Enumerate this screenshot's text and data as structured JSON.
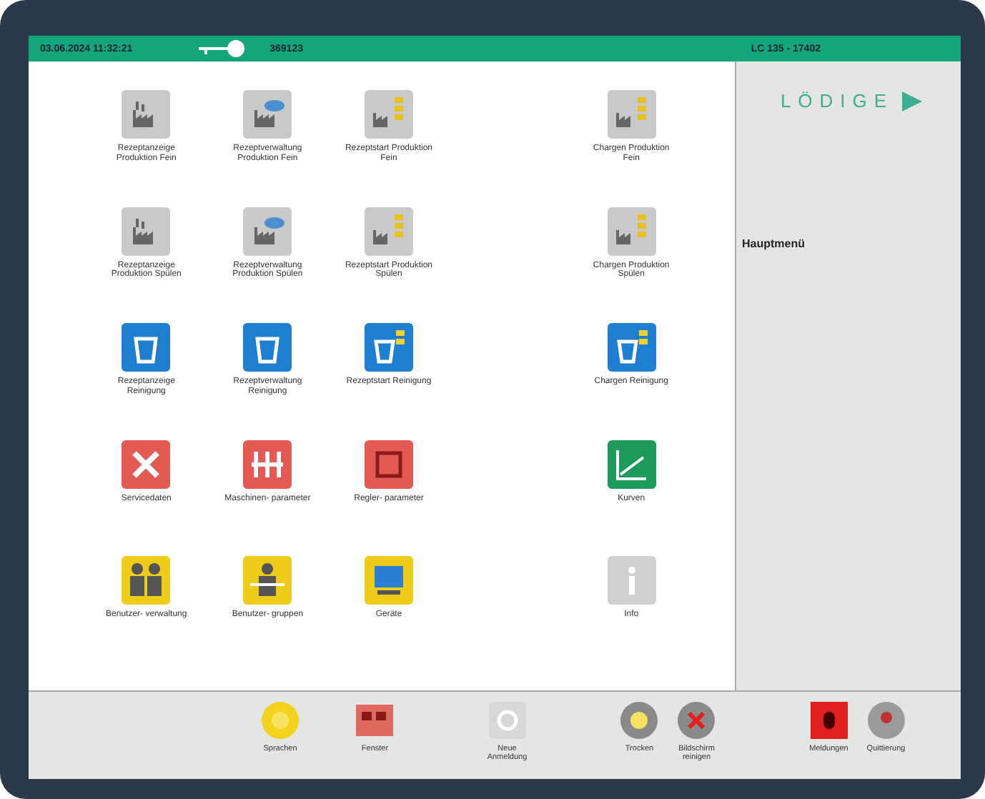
{
  "header": {
    "datetime": "03.06.2024  11:32:21",
    "user_id": "369123",
    "machine": "LC 135 - 17402"
  },
  "menu_rows": [
    {
      "tiles": [
        {
          "label": "Rezeptanzeige Produktion Fein",
          "kind": "factory",
          "color": "#c9c9c9"
        },
        {
          "label": "Rezeptverwaltung Produktion Fein",
          "kind": "factory-cloud",
          "color": "#c9c9c9"
        },
        {
          "label": "Rezeptstart Produktion Fein",
          "kind": "factory-coins",
          "color": "#c9c9c9"
        },
        {
          "label": "Chargen Produktion Fein",
          "kind": "factory-coins",
          "color": "#c9c9c9"
        }
      ]
    },
    {
      "tiles": [
        {
          "label": "Rezeptanzeige Produktion Spülen",
          "kind": "factory",
          "color": "#c9c9c9"
        },
        {
          "label": "Rezeptverwaltung Produktion Spülen",
          "kind": "factory-cloud",
          "color": "#c9c9c9"
        },
        {
          "label": "Rezeptstart Produktion Spülen",
          "kind": "factory-coins",
          "color": "#c9c9c9"
        },
        {
          "label": "Chargen Produktion Spülen",
          "kind": "factory-coins",
          "color": "#c9c9c9"
        }
      ]
    },
    {
      "tiles": [
        {
          "label": "Rezeptanzeige Reinigung",
          "kind": "bucket",
          "color": "#1e7fd0"
        },
        {
          "label": "Rezeptverwaltung Reinigung",
          "kind": "bucket",
          "color": "#1e7fd0"
        },
        {
          "label": "Rezeptstart Reinigung",
          "kind": "bucket-coins",
          "color": "#1e7fd0"
        },
        {
          "label": "Chargen Reinigung",
          "kind": "bucket-coins",
          "color": "#1e7fd0"
        }
      ]
    },
    {
      "tiles": [
        {
          "label": "Servicedaten",
          "kind": "tools",
          "color": "#e25a52"
        },
        {
          "label": "Maschinen- parameter",
          "kind": "sliders",
          "color": "#e25a52"
        },
        {
          "label": "Regler- parameter",
          "kind": "chip",
          "color": "#e25a52"
        },
        {
          "label": "Kurven",
          "kind": "chart",
          "color": "#1e9a5a"
        }
      ]
    },
    {
      "tiles": [
        {
          "label": "Benutzer- verwaltung",
          "kind": "people",
          "color": "#f0cc1a"
        },
        {
          "label": "Benutzer- gruppen",
          "kind": "person",
          "color": "#f0cc1a"
        },
        {
          "label": "Geräte",
          "kind": "monitor",
          "color": "#f0cc1a"
        },
        {
          "label": "Info",
          "kind": "info",
          "color": "#d0d0d0"
        }
      ]
    }
  ],
  "side_panel": {
    "logo": "LÖDIGE",
    "title": "Hauptmenü"
  },
  "bottom_bar": [
    {
      "label": "Sprachen",
      "kind": "sun",
      "color": "#f2d21c"
    },
    {
      "label": "Fenster",
      "kind": "windows",
      "color": "#e06a60"
    },
    {
      "label": "Neue Anmeldung",
      "kind": "ring",
      "color": "#d8d8d8"
    },
    {
      "label": "Trocken",
      "kind": "sun",
      "color": "#8a8a8a"
    },
    {
      "label": "Bildschirm reinigen",
      "kind": "cross",
      "color": "#8a8a8a"
    },
    {
      "label": "Meldungen",
      "kind": "alarm",
      "color": "#e02020"
    },
    {
      "label": "Quittierung",
      "kind": "heart",
      "color": "#9a9a9a"
    }
  ]
}
